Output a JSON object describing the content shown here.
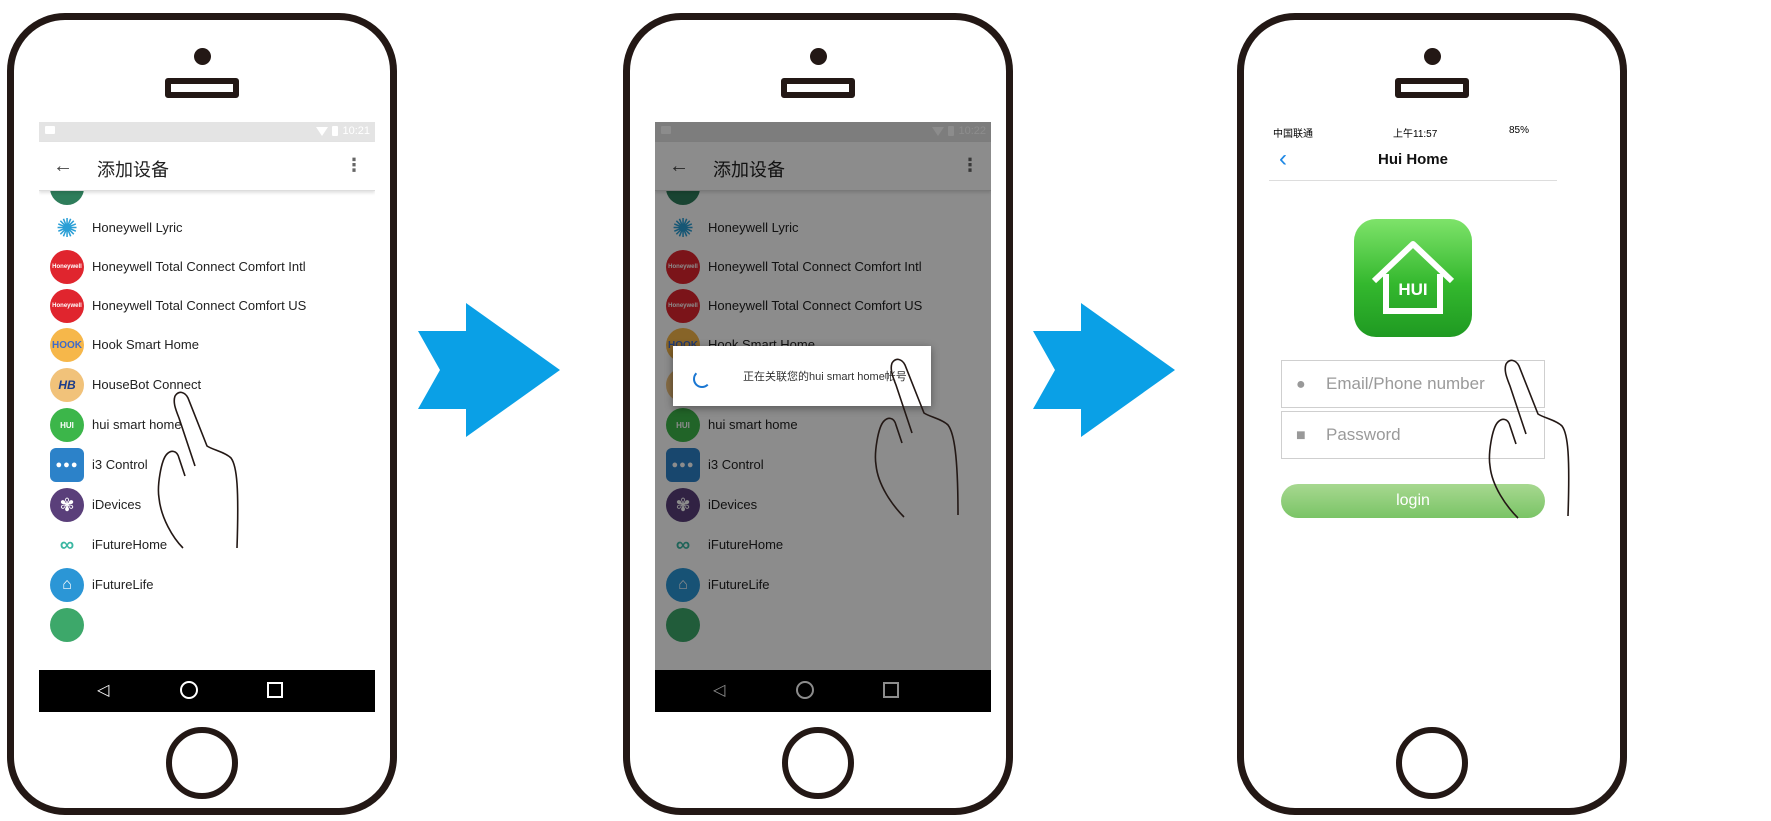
{
  "colors": {
    "arrow": "#0aa0e6",
    "frame": "#231815",
    "hui_green": "#34b82e",
    "android_accent": "#1976d2",
    "ios_blue": "#1e88e5"
  },
  "android_status_time_1": "10:21",
  "android_status_time_2": "10:22",
  "android_app_bar": {
    "title": "添加设备",
    "back_icon": "arrow-back-icon",
    "menu_icon": "more-vert-icon"
  },
  "device_list": [
    {
      "label": "Honeywell Lyric",
      "icon_text": ""
    },
    {
      "label": "Honeywell Total Connect Comfort Intl",
      "icon_text": "Honeywell"
    },
    {
      "label": "Honeywell Total Connect Comfort US",
      "icon_text": "Honeywell"
    },
    {
      "label": "Hook Smart Home",
      "icon_text": "HOOK"
    },
    {
      "label": "HouseBot Connect",
      "icon_text": "HB"
    },
    {
      "label": "hui smart home",
      "icon_text": "HUI"
    },
    {
      "label": "i3 Control",
      "icon_text": ""
    },
    {
      "label": "iDevices",
      "icon_text": ""
    },
    {
      "label": "iFutureHome",
      "icon_text": ""
    },
    {
      "label": "iFutureLife",
      "icon_text": ""
    }
  ],
  "dialog": {
    "message": "正在关联您的hui smart home帐号"
  },
  "ios": {
    "carrier": "中国联通",
    "time": "上午11:57",
    "battery": "85%",
    "nav_title": "Hui Home",
    "logo_text": "HUI",
    "email_placeholder": "Email/Phone number",
    "password_placeholder": "Password",
    "login_label": "login"
  }
}
